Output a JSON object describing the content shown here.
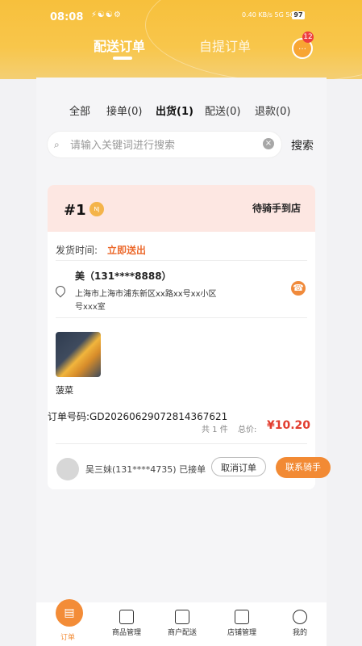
{
  "status": {
    "time": "08:08",
    "battery": "97",
    "indicator_text": "0.40 KB/s 5G 5G"
  },
  "top_tabs": {
    "delivery": "配送订单",
    "pickup": "自提订单",
    "notifications": "12"
  },
  "filters": [
    {
      "label": "全部"
    },
    {
      "label": "接单(0)"
    },
    {
      "label": "出货(1)"
    },
    {
      "label": "配送(0)"
    },
    {
      "label": "退款(0)"
    }
  ],
  "search": {
    "placeholder": "请输入关键词进行搜索",
    "button": "搜索"
  },
  "order": {
    "number": "#1",
    "tag": "NJ",
    "state": "待骑手到店",
    "ship_label": "发货时间:",
    "ship_value": "立即送出",
    "customer": "美（131****8888）",
    "address_line1": "上海市上海市浦东新区xx路xx号xx小区",
    "address_line2": "号xxx室",
    "product": "菠菜",
    "code": "订单号码:GD20260629072814367621",
    "qty": "共 1 件",
    "total_label": "总价:",
    "total_value": "¥10.20",
    "rider": "吴三妹(131****4735) 已接单",
    "cancel": "取消订单",
    "contact": "联系骑手"
  },
  "nav": [
    {
      "label": "订单"
    },
    {
      "label": "商品管理"
    },
    {
      "label": "商户配送"
    },
    {
      "label": "店铺管理"
    },
    {
      "label": "我的"
    }
  ],
  "colors": {
    "brand": "#f7c03c",
    "accent": "#f28a34",
    "price": "#e23d2f"
  }
}
